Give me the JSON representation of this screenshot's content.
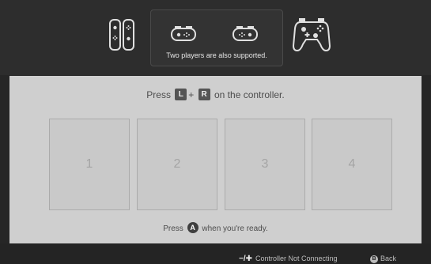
{
  "tooltip": {
    "text": "Two players are also supported."
  },
  "instruction": {
    "prefix": "Press",
    "button_l": "L",
    "plus": "+",
    "button_r": "R",
    "suffix": "on the controller."
  },
  "slots": [
    "1",
    "2",
    "3",
    "4"
  ],
  "ready": {
    "prefix": "Press",
    "button_a": "A",
    "suffix": "when you're ready."
  },
  "footer": {
    "minus_plus": "−/✚",
    "not_connecting_label": "Controller Not Connecting",
    "back_badge": "B",
    "back_label": "Back"
  },
  "icons": {
    "joycon_pair_vertical": "joycon-pair-icon",
    "joycon_sideways": "joycon-sideways-icon",
    "pro_controller": "pro-controller-icon"
  }
}
